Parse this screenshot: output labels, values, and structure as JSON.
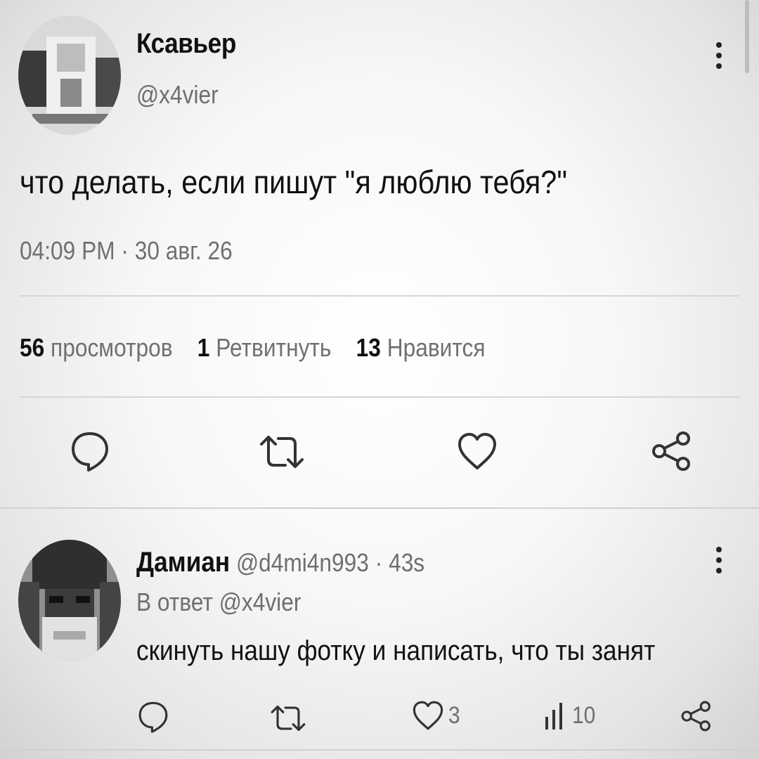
{
  "tweet": {
    "author_name": "Ксавьер",
    "author_handle": "@x4vier",
    "text": "что делать, если пишут \"я люблю тебя?\"",
    "timestamp": "04:09 PM · 30 авг. 26",
    "stats": {
      "views_count": "56",
      "views_label": "просмотров",
      "retweets_count": "1",
      "retweets_label": "Ретвитнуть",
      "likes_count": "13",
      "likes_label": "Нравится"
    },
    "actions": [
      "reply-icon",
      "retweet-icon",
      "like-icon",
      "share-icon"
    ]
  },
  "reply": {
    "author_name": "Дамиан",
    "author_handle": "@d4mi4n993",
    "time": "· 43s",
    "in_reply_to": "В ответ @x4vier",
    "text": "скинуть нашу фотку и написать, что ты занят",
    "likes": "3",
    "views": "10",
    "actions": [
      "reply-icon",
      "retweet-icon",
      "like-icon",
      "views-icon",
      "share-icon"
    ]
  },
  "colors": {
    "text": "#111111",
    "muted": "#6f6f6f",
    "divider": "#d6d6d6"
  }
}
